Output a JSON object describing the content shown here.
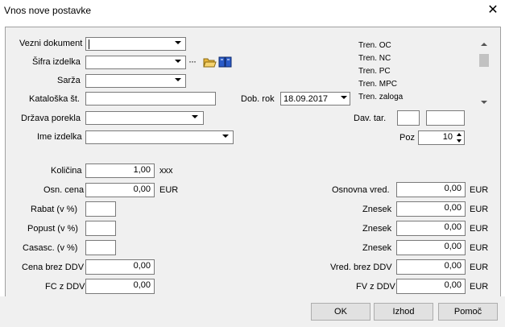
{
  "window": {
    "title": "Vnos nove postavke"
  },
  "form": {
    "vezni_dokument": {
      "label": "Vezni dokument",
      "value": ""
    },
    "sifra_izdelka": {
      "label": "Šifra izdelka",
      "value": "",
      "ellipsis": "···"
    },
    "sarza": {
      "label": "Sarža",
      "value": ""
    },
    "kataloska": {
      "label": "Kataloška št.",
      "value": ""
    },
    "dob_rok": {
      "label": "Dob. rok",
      "value": "18.09.2017"
    },
    "drzava_porekla": {
      "label": "Država porekla",
      "value": ""
    },
    "ime_izdelka": {
      "label": "Ime izdelka",
      "value": ""
    },
    "dav_tar": {
      "label": "Dav. tar.",
      "value1": "",
      "value2": ""
    },
    "poz": {
      "label": "Poz",
      "value": "10"
    },
    "kolicina": {
      "label": "Količina",
      "value": "1,00",
      "unit": "xxx"
    },
    "osn_cena": {
      "label": "Osn. cena",
      "value": "0,00",
      "unit": "EUR"
    },
    "rabat": {
      "label": "Rabat (v %)",
      "value": ""
    },
    "popust": {
      "label": "Popust (v %)",
      "value": ""
    },
    "casasc": {
      "label": "Casasc. (v %)",
      "value": ""
    },
    "cena_brez_ddv": {
      "label": "Cena brez DDV",
      "value": "0,00"
    },
    "fc_z_ddv": {
      "label": "FC z DDV",
      "value": "0,00"
    },
    "osnovna_vred": {
      "label": "Osnovna vred.",
      "value": "0,00",
      "unit": "EUR"
    },
    "znesek1": {
      "label": "Znesek",
      "value": "0,00",
      "unit": "EUR"
    },
    "znesek2": {
      "label": "Znesek",
      "value": "0,00",
      "unit": "EUR"
    },
    "znesek3": {
      "label": "Znesek",
      "value": "0,00",
      "unit": "EUR"
    },
    "vred_brez_ddv": {
      "label": "Vred. brez DDV",
      "value": "0,00",
      "unit": "EUR"
    },
    "fv_z_ddv": {
      "label": "FV z DDV",
      "value": "0,00",
      "unit": "EUR"
    }
  },
  "info_panel": {
    "items": [
      "Tren. OC",
      "Tren. NC",
      "Tren. PC",
      "Tren. MPC",
      "Tren. zaloga"
    ]
  },
  "buttons": {
    "ok": "OK",
    "izhod": "Izhod",
    "pomoc": "Pomoč"
  },
  "colors": {
    "client_bg": "#f0f0f0",
    "button_bg": "#e1e1e1",
    "folder_icon": "#e8b53a",
    "book_icon": "#2a5bc8"
  }
}
